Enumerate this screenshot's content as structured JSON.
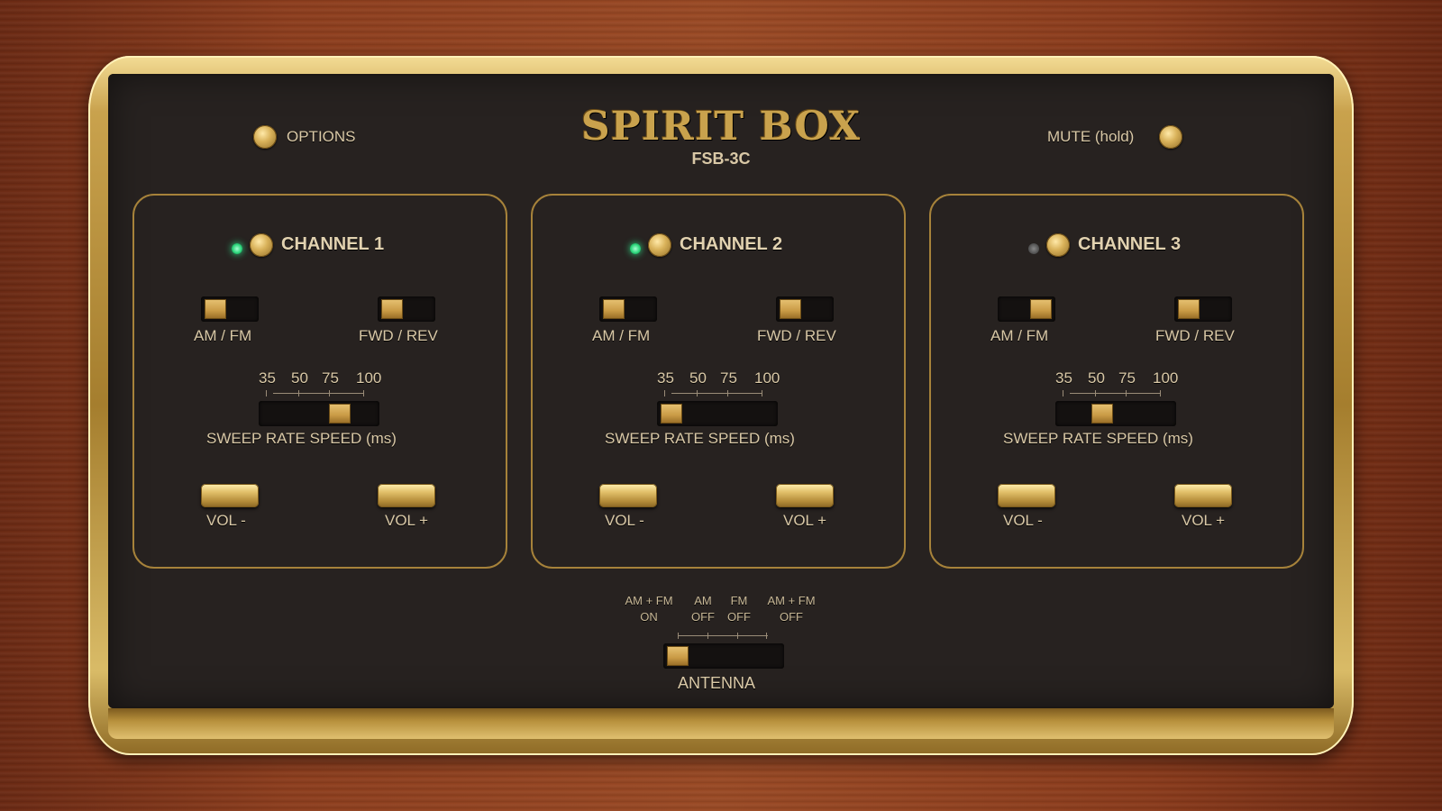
{
  "header": {
    "options_label": "OPTIONS",
    "logo": "SPIRIT BOX",
    "model": "FSB-3C",
    "mute_label": "MUTE (hold)"
  },
  "channels": [
    {
      "title": "CHANNEL 1",
      "active": true,
      "mode_label": "AM / FM",
      "mode_value": "AM",
      "direction_label": "FWD / REV",
      "direction_value": "FWD",
      "sweep_ticks": [
        "35",
        "50",
        "75",
        "100"
      ],
      "sweep_value": "75",
      "sweep_label": "SWEEP RATE SPEED (ms)",
      "vol_down_label": "VOL -",
      "vol_up_label": "VOL +"
    },
    {
      "title": "CHANNEL 2",
      "active": true,
      "mode_label": "AM / FM",
      "mode_value": "AM",
      "direction_label": "FWD / REV",
      "direction_value": "FWD",
      "sweep_ticks": [
        "35",
        "50",
        "75",
        "100"
      ],
      "sweep_value": "35",
      "sweep_label": "SWEEP RATE SPEED (ms)",
      "vol_down_label": "VOL -",
      "vol_up_label": "VOL +"
    },
    {
      "title": "CHANNEL 3",
      "active": false,
      "mode_label": "AM / FM",
      "mode_value": "FM",
      "direction_label": "FWD / REV",
      "direction_value": "FWD",
      "sweep_ticks": [
        "35",
        "50",
        "75",
        "100"
      ],
      "sweep_value": "50",
      "sweep_label": "SWEEP RATE SPEED (ms)",
      "vol_down_label": "VOL -",
      "vol_up_label": "VOL +"
    }
  ],
  "antenna": {
    "label": "ANTENNA",
    "options": [
      {
        "line1": "AM + FM",
        "line2": "ON"
      },
      {
        "line1": "AM",
        "line2": "OFF"
      },
      {
        "line1": "FM",
        "line2": "OFF"
      },
      {
        "line1": "AM + FM",
        "line2": "OFF"
      }
    ],
    "selected_index": 0
  },
  "colors": {
    "panel": "#272220",
    "gold": "#c9a24d",
    "led_on": "#2ed67c",
    "led_off": "#555555",
    "wood": "#8d3e1e"
  }
}
